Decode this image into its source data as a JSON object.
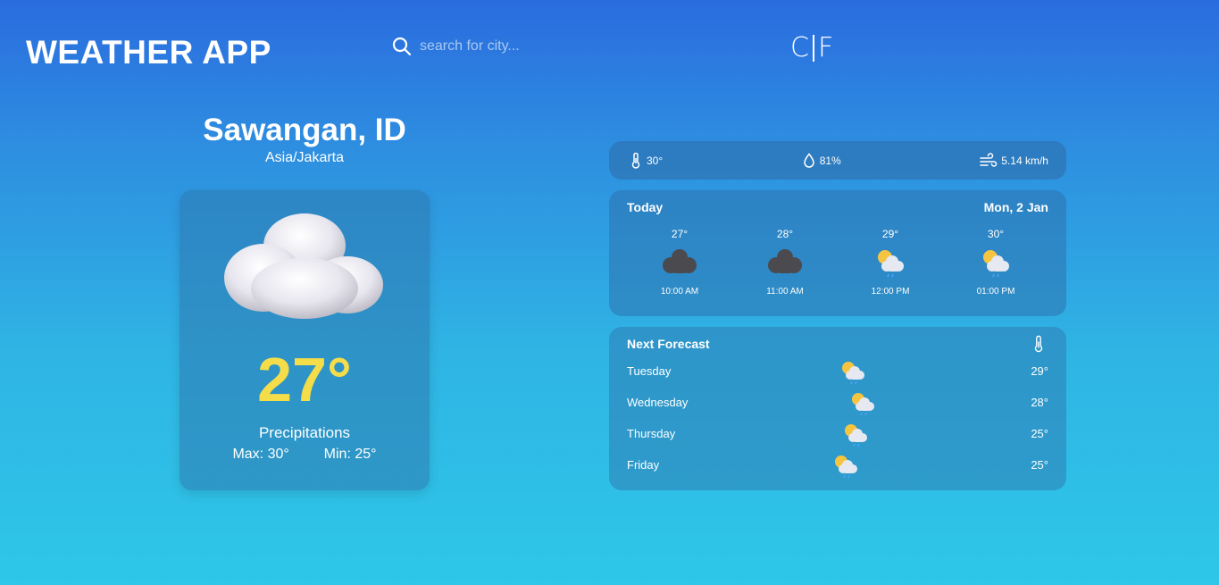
{
  "header": {
    "app_title": "WEATHER APP",
    "search_placeholder": "search for city...",
    "unit_celsius": "C",
    "unit_fahrenheit": "F"
  },
  "location": {
    "city": "Sawangan, ID",
    "timezone": "Asia/Jakarta"
  },
  "current": {
    "icon": "cloud-icon",
    "temp": "27°",
    "condition": "Precipitations",
    "max": "Max: 30°",
    "min": "Min: 25°"
  },
  "stats": {
    "feels_like": "30°",
    "humidity": "81%",
    "wind": "5.14 km/h"
  },
  "today": {
    "label": "Today",
    "date": "Mon, 2 Jan",
    "hours": [
      {
        "temp": "27°",
        "icon": "dark-cloud-icon",
        "time": "10:00 AM"
      },
      {
        "temp": "28°",
        "icon": "dark-cloud-icon",
        "time": "11:00 AM"
      },
      {
        "temp": "29°",
        "icon": "sun-rain-cloud-icon",
        "time": "12:00 PM"
      },
      {
        "temp": "30°",
        "icon": "sun-rain-cloud-icon",
        "time": "01:00 PM"
      }
    ]
  },
  "forecast": {
    "label": "Next Forecast",
    "days": [
      {
        "day": "Tuesday",
        "icon": "sun-rain-cloud-icon",
        "temp": "29°"
      },
      {
        "day": "Wednesday",
        "icon": "sun-rain-cloud-icon",
        "temp": "28°"
      },
      {
        "day": "Thursday",
        "icon": "sun-rain-cloud-icon",
        "temp": "25°"
      },
      {
        "day": "Friday",
        "icon": "sun-rain-cloud-icon",
        "temp": "25°"
      }
    ]
  },
  "colors": {
    "temp_accent": "#f5dd4a",
    "bg_top": "#2a6cdf",
    "bg_bottom": "#2ec7e8"
  }
}
